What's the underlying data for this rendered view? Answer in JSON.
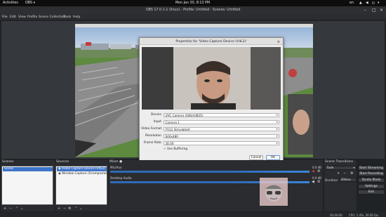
{
  "topbar": {
    "activities": "Activities",
    "app": "OBS",
    "clock": "Mon Jan 30, 8:13 PM",
    "lang": "en"
  },
  "window": {
    "title": "OBS 17.0.1-1 (linux) - Profile: Untitled - Scenes: Untitled"
  },
  "menu": [
    "File",
    "Edit",
    "View",
    "Profile",
    "Scene Collection",
    "Tools",
    "Help"
  ],
  "dialog": {
    "title": "Properties for 'Video Capture Device (V4L2)'",
    "fields": [
      {
        "label": "Device",
        "value": "UVC Camera (046d:0825)"
      },
      {
        "label": "Input",
        "value": "Camera 1"
      },
      {
        "label": "Video Format",
        "value": "YV12 (Emulated)"
      },
      {
        "label": "Resolution",
        "value": "640x480"
      },
      {
        "label": "Frame Rate",
        "value": "30.00"
      }
    ],
    "use_buffering": "Use Buffering",
    "cancel": "Cancel",
    "ok": "OK"
  },
  "scenes": {
    "title": "Scenes",
    "items": [
      "Scene"
    ]
  },
  "sources": {
    "title": "Sources",
    "items": [
      "Video Capture Device (V4L2)",
      "Window Capture (Xcomposite)"
    ]
  },
  "mixer": {
    "title": "Mixer",
    "channels": [
      {
        "name": "Mic/Aux",
        "db": "0.0 dB",
        "level": 0.95
      },
      {
        "name": "Desktop Audio",
        "db": "0.0 dB",
        "level": 0.95
      }
    ]
  },
  "transitions": {
    "title": "Scene Transitions",
    "type": "Fade",
    "duration_label": "Duration",
    "duration_value": "300ms"
  },
  "controls": [
    "Start Streaming",
    "Start Recording",
    "Studio Mode",
    "Settings",
    "Exit"
  ],
  "status": {
    "time": "00:00:00",
    "cpu": "CPU: 1.4%, 30.00 fps"
  },
  "colors": {
    "selection": "#3d74c9",
    "record_red": "#d83a3a",
    "meter_blue": "#2f6ab7"
  }
}
